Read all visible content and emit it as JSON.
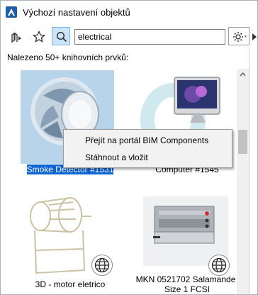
{
  "window": {
    "title": "Výchozí nastavení objektů"
  },
  "toolbar": {
    "search_value": "electrical"
  },
  "status_text": "Nalezeno 50+ knihovních prvků:",
  "items": [
    {
      "label": "Smoke Detector #1531"
    },
    {
      "label": "Computer #1545"
    },
    {
      "label": "3D - motor eletrico"
    },
    {
      "label_line1": "MKN 0521702 Salamander",
      "label_line2": "Size 1 FCSI"
    }
  ],
  "context_menu": {
    "items": [
      "Přejít na portál BIM Components",
      "Stáhnout a vložit"
    ]
  },
  "colors": {
    "accent": "#0a64d2",
    "active_button": "#cce4f7"
  },
  "icons": [
    "app-icon",
    "library-browse-icon",
    "star-icon",
    "search-icon",
    "gear-icon",
    "globe-icon"
  ]
}
